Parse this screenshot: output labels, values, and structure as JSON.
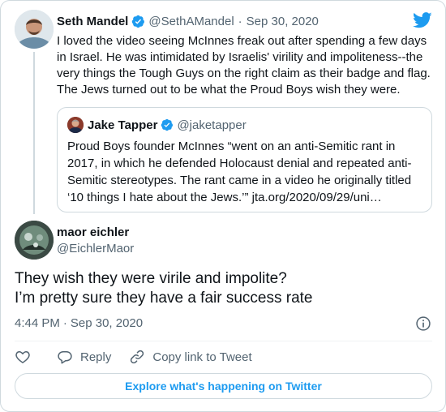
{
  "parent_tweet": {
    "name": "Seth Mandel",
    "handle": "@SethAMandel",
    "separator": "·",
    "date": "Sep 30, 2020",
    "text": "I loved the video seeing McInnes freak out after spending a few days in Israel. He was intimidated by Israelis' virility and impoliteness--the very things the Tough Guys on the right claim as their badge and flag. The Jews turned out to be what the Proud Boys wish they were."
  },
  "quoted_tweet": {
    "name": "Jake Tapper",
    "handle": "@jaketapper",
    "text": "Proud Boys founder McInnes “went on an anti-Semitic rant in 2017, in which he defended Holocaust denial and repeated anti-Semitic stereotypes. The rant came in a video he originally titled ‘10 things I hate about the Jews.’” jta.org/2020/09/29/uni…"
  },
  "main_tweet": {
    "name": "maor eichler",
    "handle": "@EichlerMaor",
    "text_line1": "They wish they were virile and impolite?",
    "text_line2": "I’m pretty sure they have a fair success rate",
    "time": "4:44 PM",
    "separator": "·",
    "date": "Sep 30, 2020"
  },
  "actions": {
    "reply_label": "Reply",
    "copy_link_label": "Copy link to Tweet"
  },
  "explore_button_label": "Explore what's happening on Twitter",
  "colors": {
    "brand_blue": "#1d9bf0",
    "text": "#0f1419",
    "muted": "#536471",
    "border": "#cfd9de"
  },
  "icons": {
    "brand": "twitter-bird-icon",
    "verified": "verified-badge-icon",
    "info": "info-icon",
    "like": "heart-icon",
    "reply": "reply-bubble-icon",
    "copy_link": "link-icon"
  }
}
